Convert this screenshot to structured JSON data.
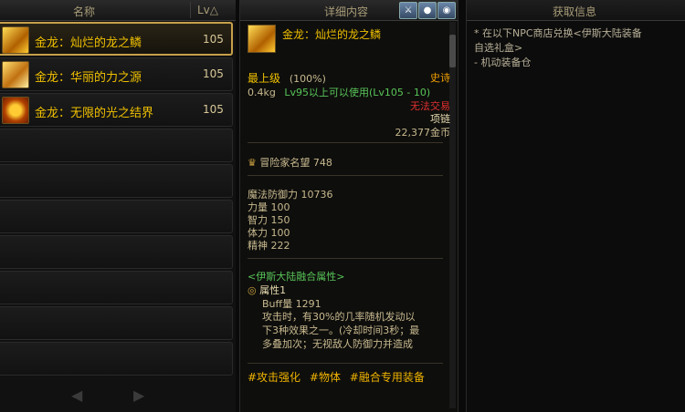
{
  "list": {
    "col_name": "名称",
    "col_lv": "Lv△",
    "items": [
      {
        "name": "金龙：灿烂的龙之鳞",
        "lv": "105"
      },
      {
        "name": "金龙：华丽的力之源",
        "lv": "105"
      },
      {
        "name": "金龙：无限的光之结界",
        "lv": "105"
      }
    ],
    "prev": "◀",
    "next": "▶"
  },
  "detail": {
    "header": "详细内容",
    "name": "金龙：灿烂的龙之鳞",
    "grade": "最上级",
    "grade_pct": "(100%)",
    "rarity": "史诗",
    "weight": "0.4kg",
    "level_req": "Lv95以上可以使用(Lv105 - 10)",
    "trade": "无法交易",
    "type": "项链",
    "price": "22,377金币",
    "fame_label": "冒险家名望",
    "fame_value": "748",
    "stats": [
      "魔法防御力 10736",
      "力量 100",
      "智力 150",
      "体力 100",
      "精神 222"
    ],
    "fusion_title": "<伊斯大陆融合属性>",
    "attr_label": "属性1",
    "buff": "Buff量 1291",
    "desc": [
      "攻击时，有30%的几率随机发动以",
      "下3种效果之一。(冷却时间3秒；最",
      "多叠加次；无视敌人防御力并造成"
    ],
    "tags": [
      "#攻击强化",
      "#物体",
      "#融合专用装备"
    ]
  },
  "source": {
    "header": "获取信息",
    "lines": [
      "* 在以下NPC商店兑换<伊斯大陆装备",
      "自选礼盒>",
      "- 机动装备仓"
    ]
  },
  "colors": {
    "gold": "#f0c000",
    "epic": "#f0a000",
    "green": "#58c458",
    "red": "#e03030",
    "tag": "#f0b400"
  }
}
